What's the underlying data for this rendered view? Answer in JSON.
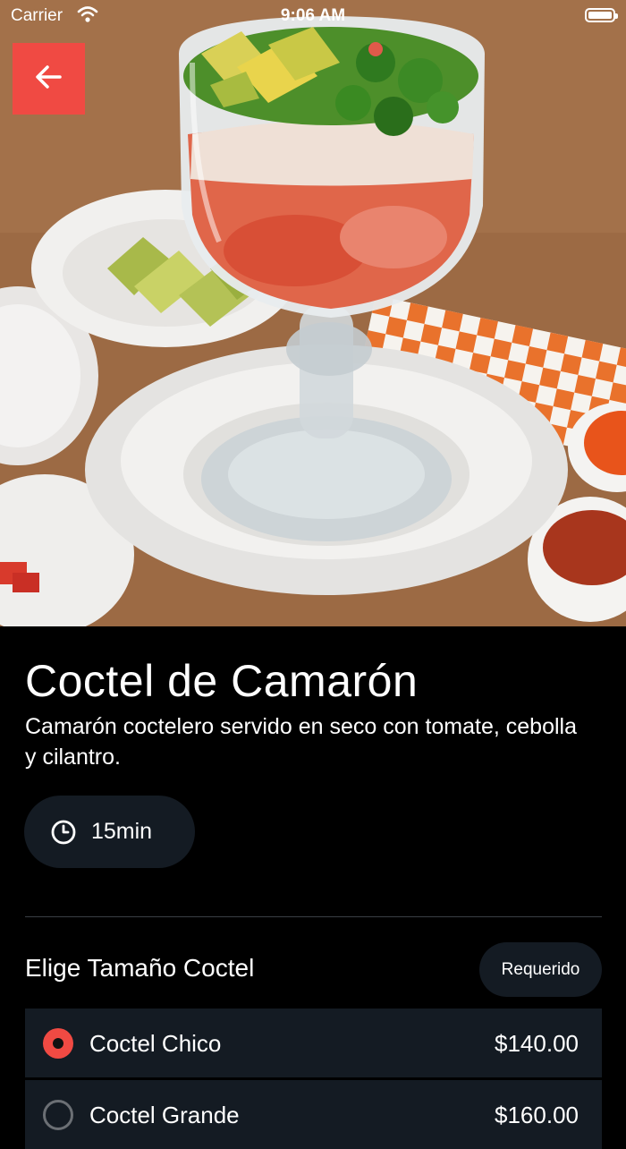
{
  "status_bar": {
    "carrier": "Carrier",
    "time": "9:06 AM"
  },
  "hero": {
    "image_alt": "Coctel de Camarón"
  },
  "product": {
    "title": "Coctel de Camarón",
    "description": "Camarón coctelero servido en seco con tomate, cebolla y cilantro.",
    "prep_time": "15min"
  },
  "section": {
    "title": "Elige Tamaño Coctel",
    "badge": "Requerido"
  },
  "options": [
    {
      "name": "Coctel Chico",
      "price": "$140.00",
      "selected": true
    },
    {
      "name": "Coctel Grande",
      "price": "$160.00",
      "selected": false
    }
  ],
  "colors": {
    "accent": "#f04a43",
    "chip_bg": "#141b23",
    "background": "#000000"
  },
  "icons": {
    "back": "arrow-left-icon",
    "clock": "clock-icon",
    "wifi": "wifi-icon",
    "battery": "battery-icon"
  }
}
